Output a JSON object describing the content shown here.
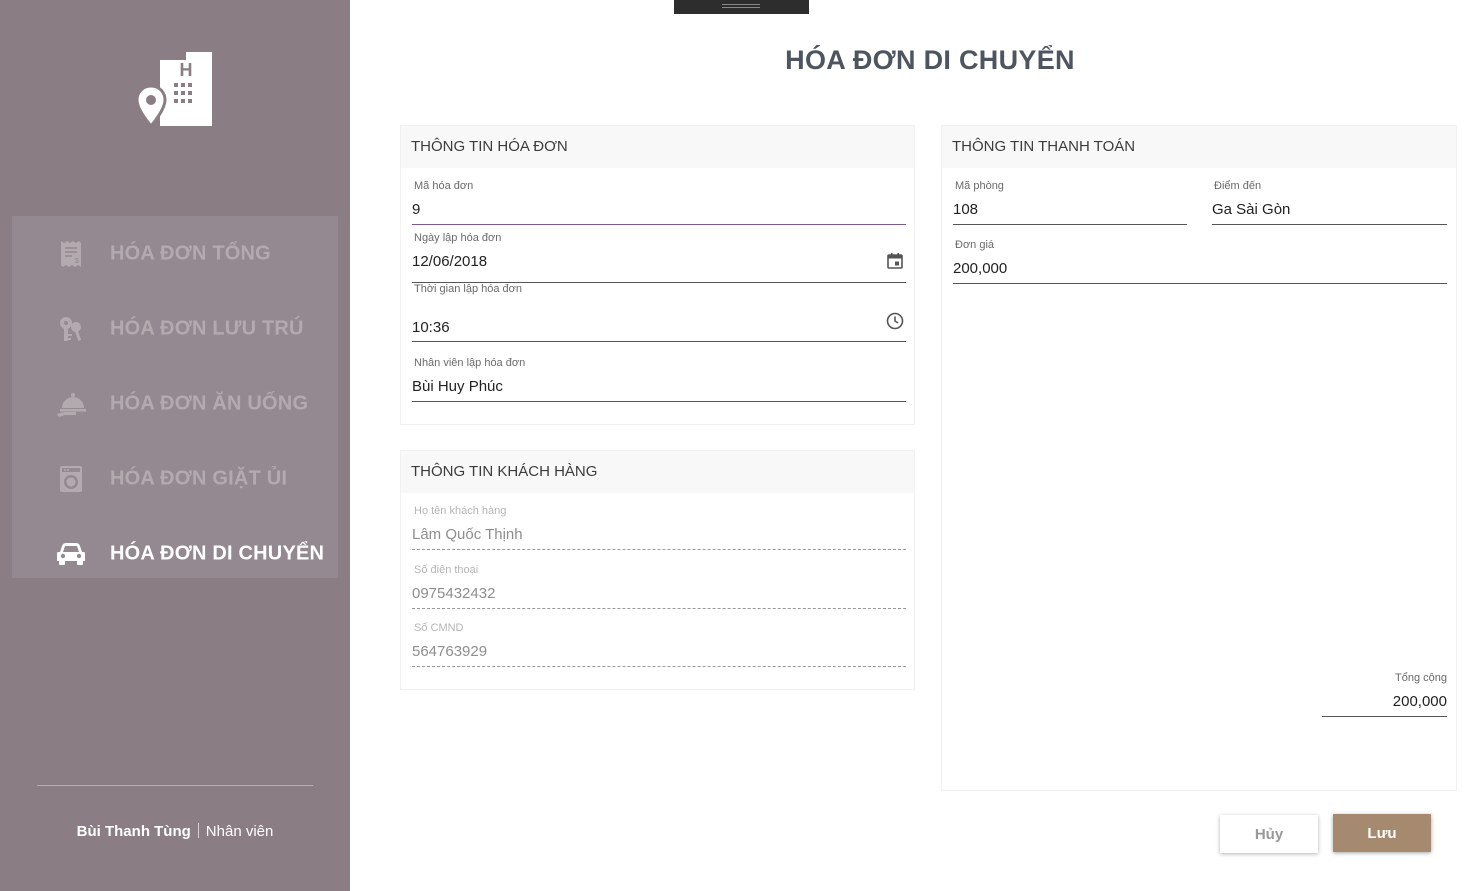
{
  "sidebar": {
    "logo_icon": "hotel-location-icon",
    "items": [
      {
        "label": "HÓA ĐƠN TỔNG",
        "icon": "receipt-icon",
        "active": false
      },
      {
        "label": "HÓA ĐƠN LƯU TRÚ",
        "icon": "keys-icon",
        "active": false
      },
      {
        "label": "HÓA ĐƠN ĂN UỐNG",
        "icon": "food-tray-icon",
        "active": false
      },
      {
        "label": "HÓA ĐƠN GIẶT ỦI",
        "icon": "washing-machine-icon",
        "active": false
      },
      {
        "label": "HÓA ĐƠN DI CHUYỂN",
        "icon": "car-icon",
        "active": true
      }
    ],
    "user": {
      "name": "Bùi Thanh Tùng",
      "role": "Nhân viên"
    }
  },
  "page": {
    "title": "HÓA ĐƠN DI CHUYỂN"
  },
  "invoice_info": {
    "header": "THÔNG TIN HÓA ĐƠN",
    "invoice_id": {
      "label": "Mã hóa đơn",
      "value": "9"
    },
    "date": {
      "label": "Ngày lập hóa đơn",
      "value": "12/06/2018"
    },
    "time": {
      "label": "Thời gian lập hóa đơn",
      "value": "10:36"
    },
    "staff": {
      "label": "Nhân viên lập hóa đơn",
      "value": "Bùi Huy Phúc"
    }
  },
  "customer_info": {
    "header": "THÔNG TIN KHÁCH HÀNG",
    "name": {
      "label": "Họ tên khách hàng",
      "value": "Lâm Quốc Thịnh"
    },
    "phone": {
      "label": "Số điện thoại",
      "value": "0975432432"
    },
    "id_card": {
      "label": "Số CMND",
      "value": "564763929"
    }
  },
  "payment_info": {
    "header": "THÔNG TIN THANH TOÁN",
    "room": {
      "label": "Mã phòng",
      "value": "108"
    },
    "destination": {
      "label": "Điểm đến",
      "value": "Ga Sài Gòn"
    },
    "unit_price": {
      "label": "Đơn giá",
      "value": "200,000"
    },
    "total": {
      "label": "Tổng cộng",
      "value": "200,000"
    }
  },
  "actions": {
    "cancel": "Hủy",
    "save": "Lưu"
  },
  "colors": {
    "sidebar": "#8a7d83",
    "save_button": "#a58a6f",
    "focus_underline": "#7b5a8f"
  }
}
